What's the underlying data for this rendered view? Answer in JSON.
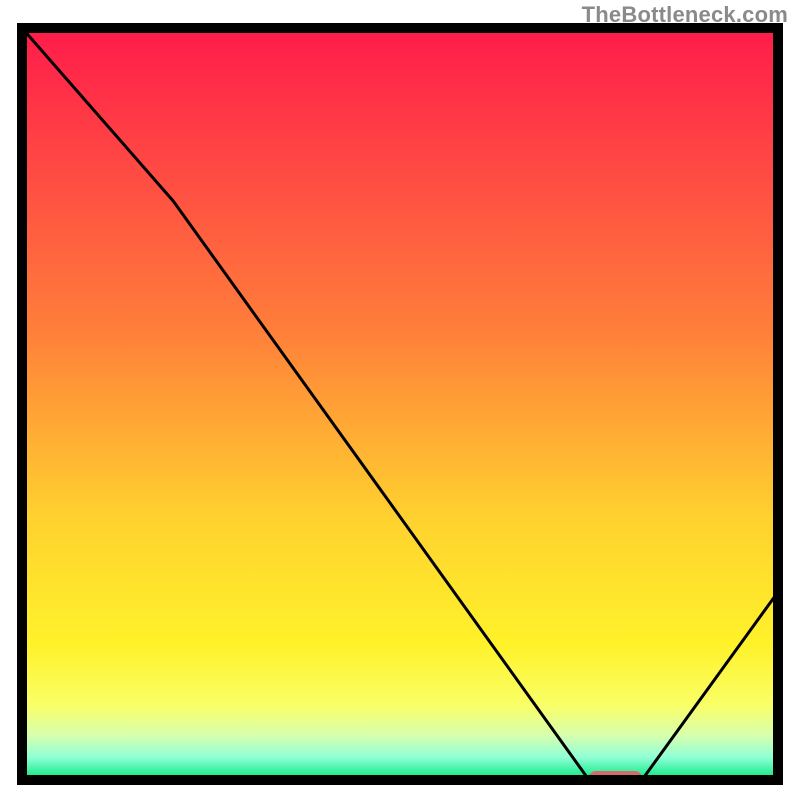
{
  "attribution": "TheBottleneck.com",
  "chart_data": {
    "type": "line",
    "title": "",
    "xlabel": "",
    "ylabel": "",
    "xlim": [
      0,
      100
    ],
    "ylim": [
      0,
      100
    ],
    "curve": [
      {
        "x": 0,
        "y": 100
      },
      {
        "x": 20,
        "y": 77
      },
      {
        "x": 75,
        "y": 0
      },
      {
        "x": 82,
        "y": 0
      },
      {
        "x": 100,
        "y": 25
      }
    ],
    "marker": {
      "x_start": 75,
      "x_end": 82,
      "y": 0
    },
    "gradient_stops": [
      {
        "offset": 0.0,
        "color": "#ff1b4b"
      },
      {
        "offset": 0.4,
        "color": "#ff7e3a"
      },
      {
        "offset": 0.65,
        "color": "#ffd12f"
      },
      {
        "offset": 0.82,
        "color": "#fff22a"
      },
      {
        "offset": 0.9,
        "color": "#f9ff66"
      },
      {
        "offset": 0.94,
        "color": "#d8ffad"
      },
      {
        "offset": 0.97,
        "color": "#8fffd6"
      },
      {
        "offset": 1.0,
        "color": "#00e77a"
      }
    ],
    "stroke_color": "#000000",
    "marker_color": "#d46a6a",
    "border_color": "#000000"
  }
}
